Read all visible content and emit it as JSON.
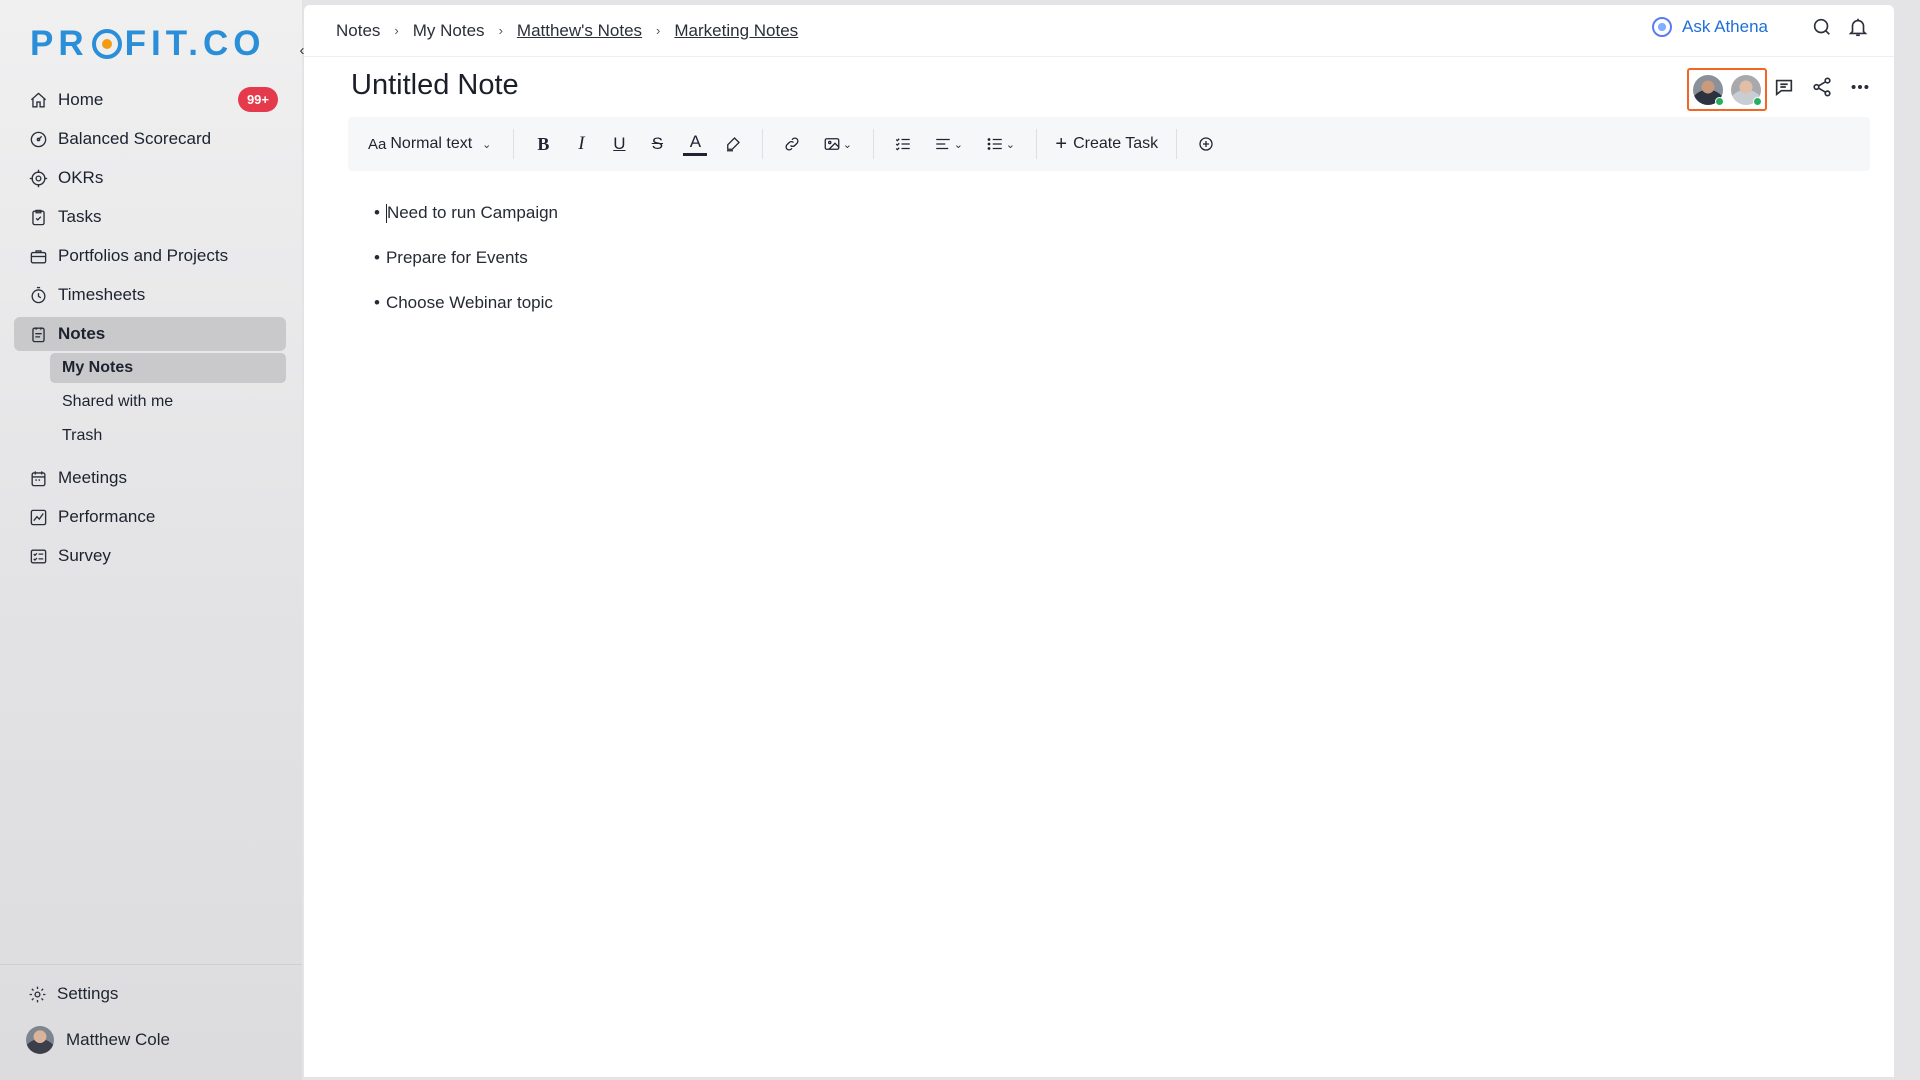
{
  "brand": {
    "logo_text_left": "PR",
    "logo_text_right": "FIT.CO"
  },
  "sidebar": {
    "items": [
      {
        "label": "Home",
        "icon": "home-icon",
        "badge": "99+"
      },
      {
        "label": "Balanced Scorecard",
        "icon": "scorecard-icon"
      },
      {
        "label": "OKRs",
        "icon": "target-icon"
      },
      {
        "label": "Tasks",
        "icon": "clipboard-check-icon"
      },
      {
        "label": "Portfolios and Projects",
        "icon": "briefcase-icon"
      },
      {
        "label": "Timesheets",
        "icon": "stopwatch-icon"
      },
      {
        "label": "Notes",
        "icon": "notes-icon",
        "active": true
      }
    ],
    "notes_sub": [
      {
        "label": "My Notes",
        "active": true
      },
      {
        "label": "Shared with me"
      },
      {
        "label": "Trash"
      }
    ],
    "items_after": [
      {
        "label": "Meetings",
        "icon": "calendar-icon"
      },
      {
        "label": "Performance",
        "icon": "trend-icon"
      },
      {
        "label": "Survey",
        "icon": "survey-icon"
      }
    ],
    "settings_label": "Settings",
    "user_name": "Matthew Cole"
  },
  "breadcrumb": [
    {
      "label": "Notes",
      "link": false
    },
    {
      "label": "My Notes",
      "link": false
    },
    {
      "label": "Matthew's Notes",
      "link": true
    },
    {
      "label": "Marketing Notes",
      "link": true
    }
  ],
  "header": {
    "ask_athena": "Ask Athena"
  },
  "note": {
    "title": "Untitled Note",
    "bullets": [
      "Need to run Campaign",
      "Prepare for Events",
      "Choose Webinar topic"
    ]
  },
  "toolbar": {
    "text_style": "Normal text",
    "text_style_icon": "Aa",
    "create_task": "Create Task"
  },
  "colors": {
    "accent": "#2a8fd8",
    "highlight_border": "#f26522",
    "badge": "#e53a4c",
    "online": "#27ae60"
  }
}
